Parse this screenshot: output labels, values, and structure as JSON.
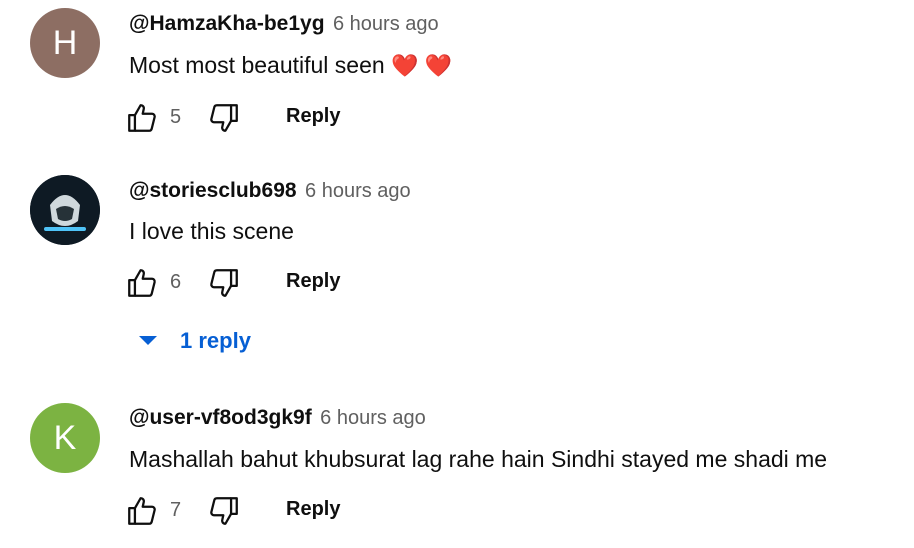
{
  "comments": [
    {
      "avatar_letter": "H",
      "avatar_color": "#8d6e63",
      "author": "@HamzaKha-be1yg",
      "time": "6 hours ago",
      "text": "Most most beautiful seen",
      "emoji": "❤️ ❤️",
      "likes": "5",
      "reply_label": "Reply"
    },
    {
      "avatar_letter": "",
      "avatar_color": "#0e1a24",
      "author": "@storiesclub698",
      "time": "6 hours ago",
      "text": "I love this scene",
      "likes": "6",
      "reply_label": "Reply",
      "replies_toggle": "1 reply"
    },
    {
      "avatar_letter": "K",
      "avatar_color": "#7cb342",
      "author": "@user-vf8od3gk9f",
      "time": "6 hours ago",
      "text": "Mashallah bahut khubsurat lag rahe hain Sindhi stayed me shadi me",
      "likes": "7",
      "reply_label": "Reply"
    }
  ]
}
